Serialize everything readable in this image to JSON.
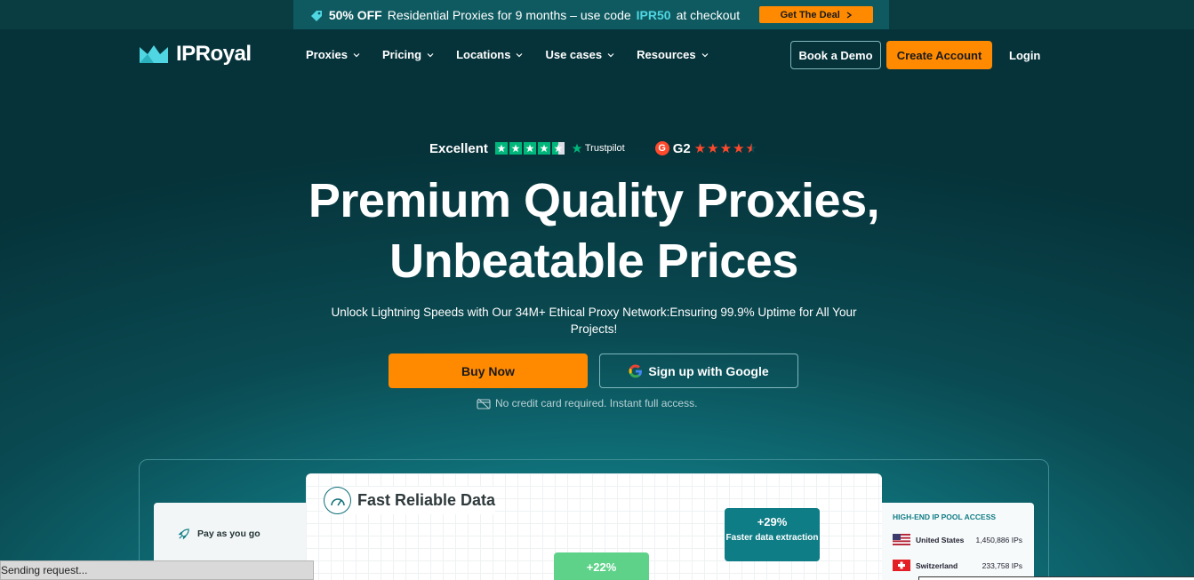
{
  "promo": {
    "highlight": "50% OFF",
    "text": "Residential Proxies for 9 months – use code",
    "code": "IPR50",
    "suffix": "at checkout",
    "cta": "Get The Deal",
    "icon": "tag-icon"
  },
  "nav": {
    "logo": "IPRoyal",
    "menu": [
      "Proxies",
      "Pricing",
      "Locations",
      "Use cases",
      "Resources"
    ],
    "book_demo": "Book a Demo",
    "create_account": "Create Account",
    "login": "Login"
  },
  "ratings": {
    "trustpilot_label": "Excellent",
    "trustpilot_brand": "Trustpilot",
    "trustpilot_stars": 4.5,
    "g2_label": "G2",
    "g2_stars": 4.5
  },
  "hero": {
    "title_line1": "Premium Quality Proxies,",
    "title_line2": "Unbeatable Prices",
    "subtitle": "Unlock Lightning Speeds with Our 34M+ Ethical Proxy Network:Ensuring 99.9% Uptime for All Your Projects!",
    "buy_now": "Buy Now",
    "google_signup": "Sign up with Google",
    "note": "No credit card required. Instant full access."
  },
  "preview": {
    "left_card": "Pay as you go",
    "main_title": "Fast Reliable Data",
    "bubble_a_value": "+29%",
    "bubble_a_text": "Faster data extraction",
    "bubble_b_value": "+22%",
    "pool_title": "HIGH-END IP POOL ACCESS",
    "pool": [
      {
        "country": "United States",
        "ips": "1,450,886 IPs"
      },
      {
        "country": "Switzerland",
        "ips": "233,758 IPs"
      }
    ]
  },
  "status_bar": "Sending request...",
  "colors": {
    "accent": "#ff8a00",
    "teal": "#0f7d86",
    "trustpilot": "#00b67a",
    "g2": "#ff492c"
  }
}
